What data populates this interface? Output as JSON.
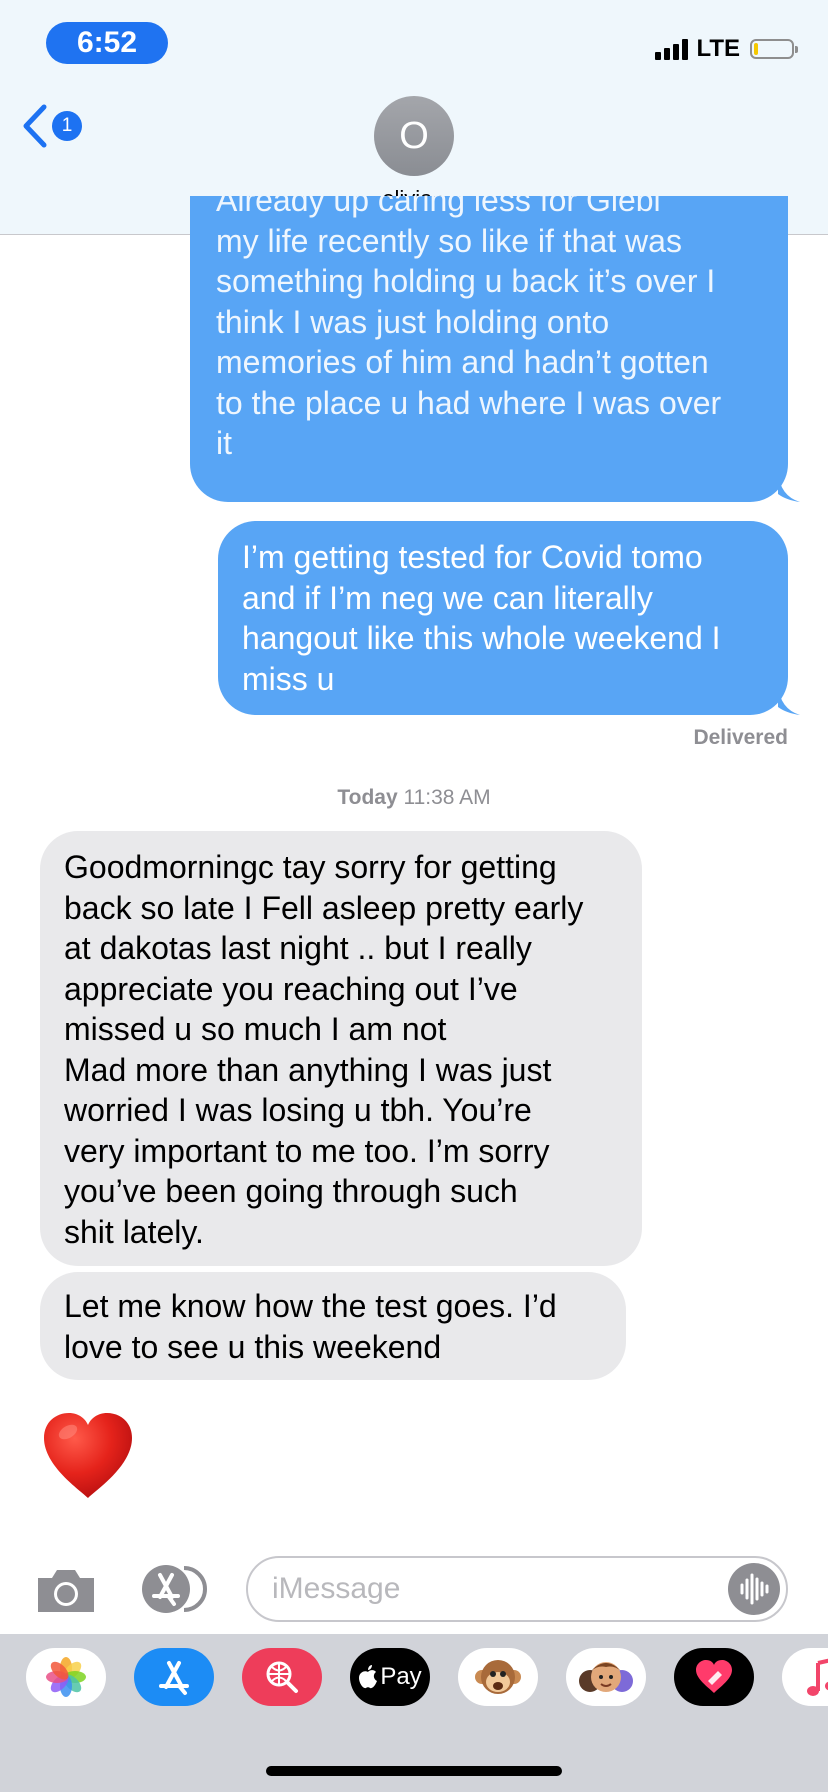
{
  "status_bar": {
    "time": "6:52",
    "network": "LTE",
    "battery_level": 0.1
  },
  "header": {
    "back_count": "1",
    "contact_initial": "O",
    "contact_name": "olivia",
    "chevron": "›"
  },
  "messages": {
    "m1": {
      "direction": "outgoing",
      "lines": [
        "Already up caring less for Giebl",
        "my life recently so like if that was",
        "something holding u back it’s over I",
        "think I was just holding onto",
        "memories of him and hadn’t gotten",
        "to the place u had where I was over",
        "it"
      ]
    },
    "m2": {
      "direction": "outgoing",
      "lines": [
        "I’m getting tested for Covid tomo",
        "and if I’m neg we can literally",
        "hangout like this whole weekend I",
        "miss u"
      ]
    },
    "delivered": "Delivered",
    "timestamp": {
      "day": "Today",
      "time": "11:38 AM"
    },
    "m3": {
      "direction": "incoming",
      "lines": [
        "Goodmorningc tay sorry for getting",
        "back so late I Fell asleep pretty early",
        "at dakotas last night .. but I really",
        "appreciate you reaching out I’ve",
        "missed u so much I am not",
        "Mad more than anything I was just",
        "worried I was losing u tbh. You’re",
        "very important to me too. I’m sorry",
        "you’ve been going through such",
        "shit lately."
      ]
    },
    "m4": {
      "direction": "incoming",
      "lines": [
        "Let me know how the test goes. I’d",
        "love to see u this weekend"
      ]
    },
    "m5": {
      "direction": "incoming",
      "emoji": "red-heart"
    }
  },
  "input": {
    "placeholder": "iMessage"
  },
  "app_drawer": {
    "apps": [
      "photos-icon",
      "app-store-icon",
      "images-search-icon",
      "apple-pay-icon",
      "animoji-monkey-icon",
      "memoji-icon",
      "digital-touch-icon",
      "music-icon"
    ],
    "apple_pay_label": "Pay"
  },
  "colors": {
    "outgoing_bubble": "#58a5f5",
    "incoming_bubble": "#e9e9eb",
    "accent": "#1d72f2"
  }
}
